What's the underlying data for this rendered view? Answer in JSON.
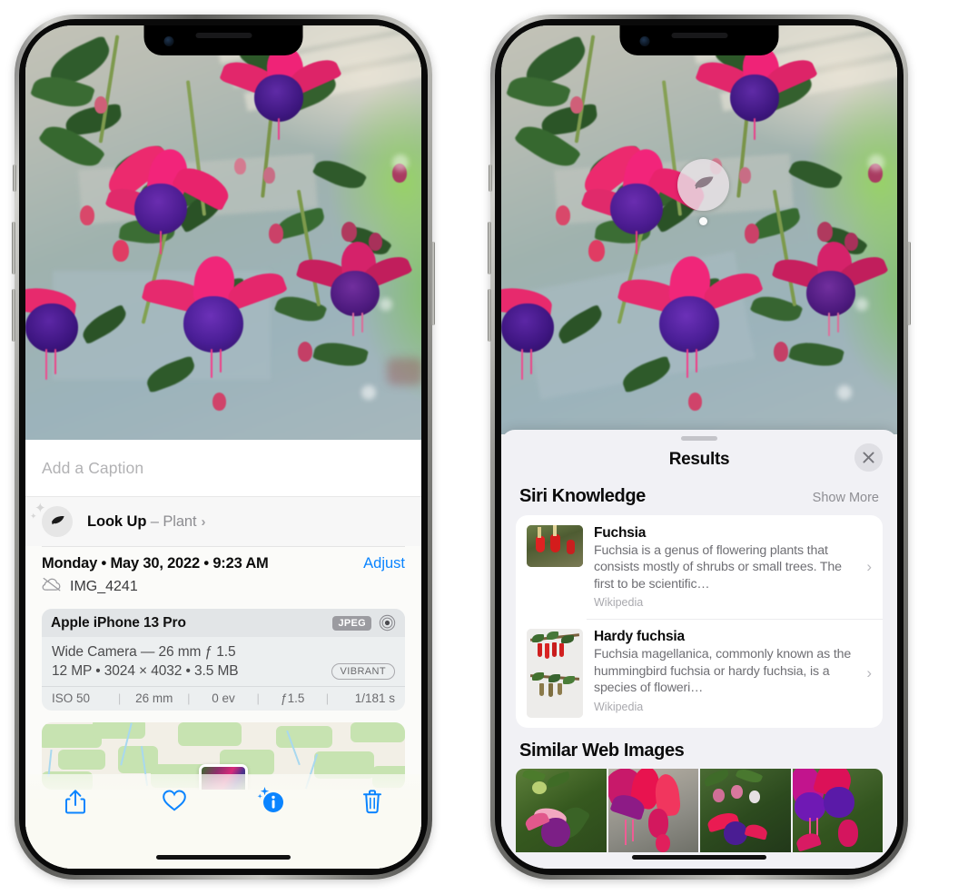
{
  "left_phone": {
    "photo": {
      "alt": "fuchsia-flowers-photo"
    },
    "caption_field": {
      "placeholder": "Add a Caption",
      "value": ""
    },
    "look_up_row": {
      "icon": "leaf-icon",
      "label": "Look Up",
      "dash": "–",
      "subject": "Plant",
      "chevron": "›"
    },
    "meta": {
      "date_line": "Monday • May 30, 2022 • 9:23 AM",
      "adjust_label": "Adjust",
      "cloud_icon": "cloud-slash-icon",
      "filename": "IMG_4241"
    },
    "camera_card": {
      "model": "Apple iPhone 13 Pro",
      "format_badge": "JPEG",
      "hdr_icon": "hdr-target-icon",
      "lens_line": "Wide Camera — 26 mm ƒ 1.5",
      "spec_line": "12 MP • 3024 × 4032 • 3.5 MB",
      "style_badge": "VIBRANT",
      "exif": [
        "ISO 50",
        "26 mm",
        "0 ev",
        "ƒ1.5",
        "1/181 s"
      ],
      "exif_separator": "|"
    },
    "map": {
      "name": "location-map-thumbnail"
    },
    "toolbar": {
      "share_label": "share-icon",
      "favorite_label": "heart-icon",
      "info_label": "info-sparkle-icon",
      "delete_label": "trash-icon",
      "accent_color": "#0a84ff"
    }
  },
  "right_phone": {
    "photo": {
      "alt": "fuchsia-flowers-photo"
    },
    "visual_lookup_badge": {
      "icon": "leaf-icon"
    },
    "sheet": {
      "title": "Results",
      "close_icon": "close-icon",
      "siri_knowledge": {
        "heading": "Siri Knowledge",
        "show_more": "Show More",
        "items": [
          {
            "title": "Fuchsia",
            "description": "Fuchsia is a genus of flowering plants that consists mostly of shrubs or small trees. The first to be scientific…",
            "source": "Wikipedia",
            "chevron": "›"
          },
          {
            "title": "Hardy fuchsia",
            "description": "Fuchsia magellanica, commonly known as the hummingbird fuchsia or hardy fuchsia, is a species of floweri…",
            "source": "Wikipedia",
            "chevron": "›"
          }
        ]
      },
      "similar_web_images": {
        "heading": "Similar Web Images",
        "thumbnails": [
          "fuchsia-web-image-1",
          "fuchsia-web-image-2",
          "fuchsia-web-image-3",
          "fuchsia-web-image-4"
        ]
      }
    }
  }
}
